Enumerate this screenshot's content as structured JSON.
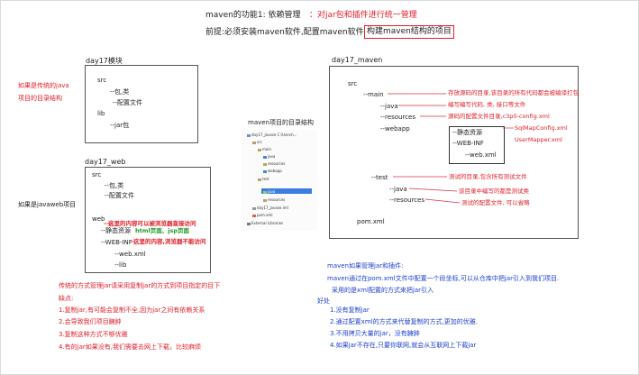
{
  "header": {
    "title": "maven的功能1: 依赖管理",
    "title_note": "：对jar包和插件进行统一管理",
    "premise": "前提:必须安装maven软件,配置maven软件",
    "premise_boxed": "构建maven结构的项目"
  },
  "day17": {
    "box_title": "day17模块",
    "side_label_1": "如果是传统的java",
    "side_label_2": "项目的目录结构",
    "lines": [
      "src",
      "--包,类",
      "--配置文件",
      "lib",
      "--jar包"
    ]
  },
  "day17_web": {
    "box_title": "day17_web",
    "side_label": "如果是javaweb项目",
    "lines": [
      "src",
      "--包,类",
      "--配置文件",
      "web",
      "--静态资源",
      "--WEB-INF",
      "--web.xml",
      "--lib"
    ],
    "note_red_1": "这里的内容可以被浏览器直接访问",
    "note_green": "html页面、jsp页面",
    "note_red_2": "这里的内容,浏览器不能访问"
  },
  "tree_panel": {
    "caption": "maven项目的目录结构",
    "items": [
      "day17_javase C:\\Users\\...",
      "src",
      "main",
      "java",
      "resources",
      "webapp",
      "test",
      "java",
      "resources",
      "day17_javase.iml",
      "pom.xml",
      "External Libraries"
    ]
  },
  "day17_maven": {
    "box_title": "day17_maven",
    "lines": [
      "src",
      "--main",
      "--java",
      "--resources",
      "--webapp",
      "--静态资源",
      "--WEB-INF",
      "--web.xml",
      "--test",
      "--java",
      "--resources",
      "pom.xml"
    ],
    "notes": [
      "存放源码的目录,该目录的所有代码都会被编译打包",
      "编写编写代码, 类, 接口等文件",
      "源码的配置文件目录,c3p0-config.xml",
      "SqlMapConfig.xml",
      "UserMapper.xml",
      "测试的目录,包含所有测试文件",
      "该目录中编写的都是测试类",
      "测试的配置文件, 可以省略"
    ]
  },
  "traditional": {
    "intro_1": "传统的方式管理jar请采用复制jar的方式到项目指定的目下",
    "intro_2": "缺点:",
    "points": [
      "1.复制jar,有可能会复制不全,因为jar之间有依赖关系",
      "2.会导致我们项目臃肿",
      "3.复制这种方式不够优雅",
      "4.有的jar如果没有,我们需要去网上下载，比较麻烦"
    ]
  },
  "maven_way": {
    "intro_1": "maven如果管理jar和插件:",
    "intro_2": "maven通过在pom.xml文件中配置一个段坐标,可以从仓库中把jar引入到我们项目.",
    "intro_3": "采用的是xml配置的方式来把jar引入",
    "advantage_label": "好处",
    "points": [
      "1.没有复制jar",
      "2.通过配置xml的方式来代替复制的方式,更加的优雅.",
      "3.不用拷贝大量的jar，没有臃肿",
      "4.如果jar不存在,只要你联网,就会从互联网上下载jar"
    ]
  }
}
